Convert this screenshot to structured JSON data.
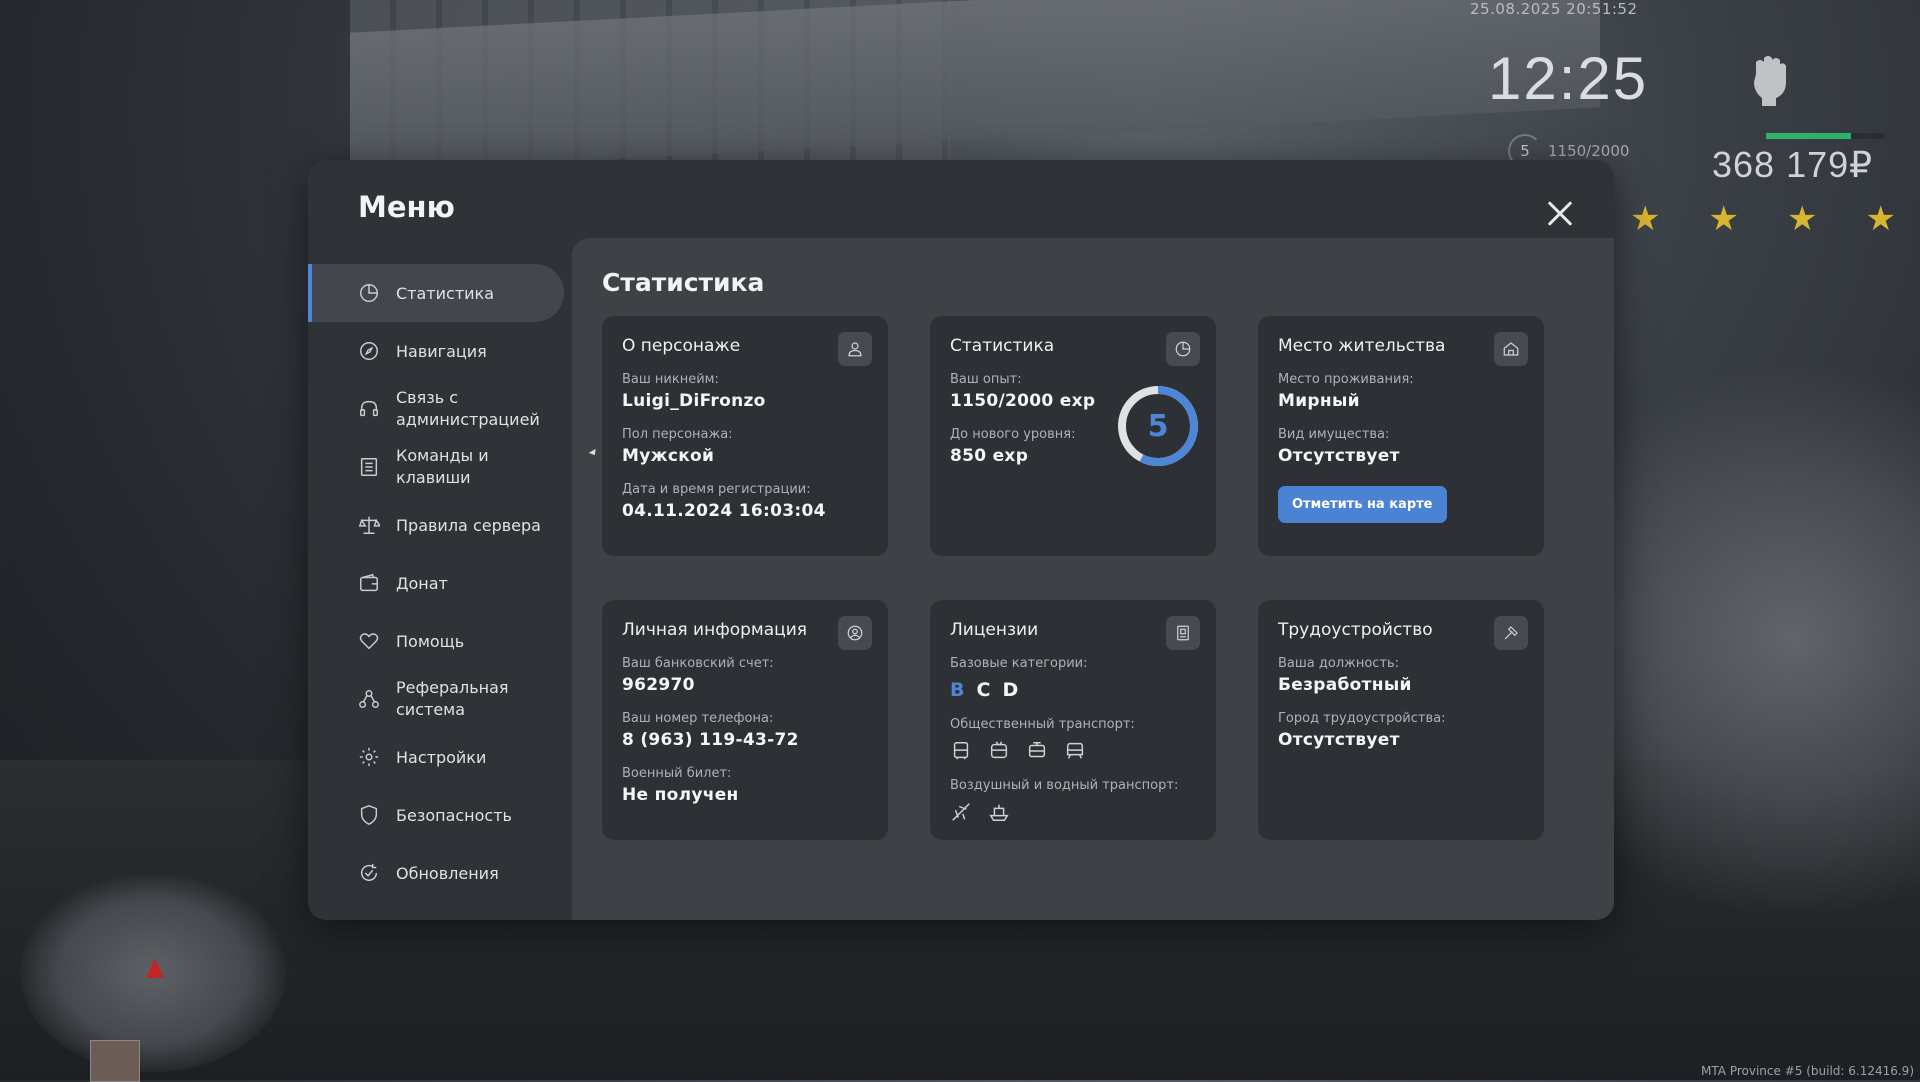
{
  "hud": {
    "date": "25.08.2025 20:51:52",
    "time": "12:25",
    "level": "5",
    "exp": "1150/2000",
    "money": "368 179₽",
    "health_fraction": 0.72,
    "stars": 4
  },
  "build": "MTA Province #5 (build: 6.12416.9)",
  "menu": {
    "title": "Меню",
    "sidebar": [
      {
        "label": "Статистика",
        "icon": "pie-chart-icon"
      },
      {
        "label": "Навигация",
        "icon": "compass-icon"
      },
      {
        "label": "Связь с администрацией",
        "icon": "headset-icon"
      },
      {
        "label": "Команды и клавиши",
        "icon": "list-icon"
      },
      {
        "label": "Правила сервера",
        "icon": "scales-icon"
      },
      {
        "label": "Донат",
        "icon": "wallet-icon"
      },
      {
        "label": "Помощь",
        "icon": "handshake-heart-icon"
      },
      {
        "label": "Реферальная система",
        "icon": "network-icon"
      },
      {
        "label": "Настройки",
        "icon": "gear-icon"
      },
      {
        "label": "Безопасность",
        "icon": "shield-icon"
      },
      {
        "label": "Обновления",
        "icon": "refresh-icon"
      }
    ],
    "content_title": "Статистика",
    "cards": {
      "character": {
        "title": "О персонаже",
        "nick_label": "Ваш никнейм:",
        "nick": "Luigi_DiFronzo",
        "gender_label": "Пол персонажа:",
        "gender": "Мужской",
        "reg_label": "Дата и время регистрации:",
        "reg": "04.11.2024 16:03:04"
      },
      "stats": {
        "title": "Статистика",
        "exp_label": "Ваш опыт:",
        "exp": "1150/2000 exp",
        "next_label": "До нового уровня:",
        "next": "850 exp",
        "level": "5",
        "progress": 0.575
      },
      "residence": {
        "title": "Место жительства",
        "place_label": "Место проживания:",
        "place": "Мирный",
        "property_label": "Вид имущества:",
        "property": "Отсутствует",
        "button": "Отметить на карте"
      },
      "personal": {
        "title": "Личная информация",
        "bank_label": "Ваш банковский счет:",
        "bank": "962970",
        "phone_label": "Ваш номер телефона:",
        "phone": "8 (963) 119-43-72",
        "military_label": "Военный билет:",
        "military": "Не получен"
      },
      "licenses": {
        "title": "Лицензии",
        "base_label": "Базовые категории:",
        "categories": [
          "B",
          "C",
          "D"
        ],
        "public_label": "Общественный транспорт:",
        "air_label": "Воздушный и водный транспорт:"
      },
      "job": {
        "title": "Трудоустройство",
        "position_label": "Ваша должность:",
        "position": "Безработный",
        "city_label": "Город трудоустройства:",
        "city": "Отсутствует"
      }
    }
  },
  "colors": {
    "accent": "#4d86d6",
    "card": "#2d3034",
    "panel": "#3e4146"
  }
}
